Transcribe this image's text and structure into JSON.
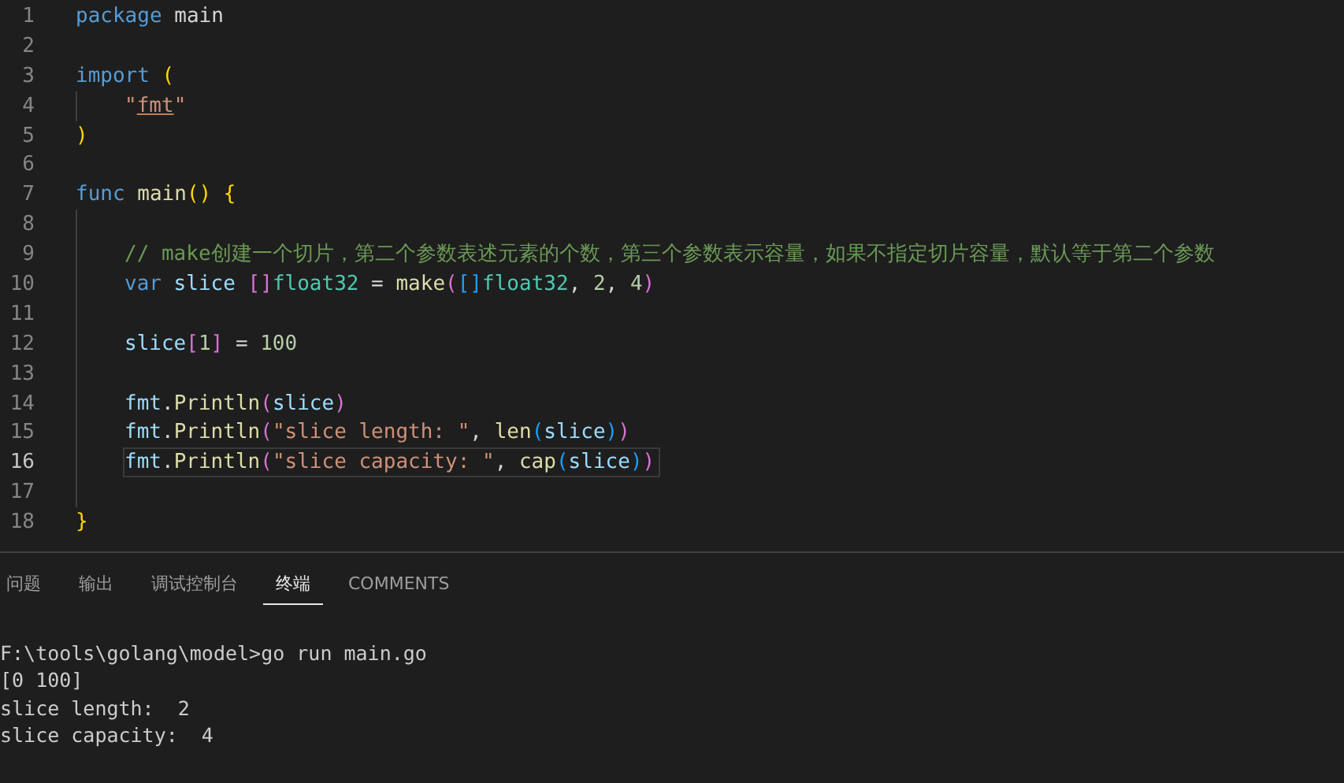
{
  "editor": {
    "lines": [
      {
        "number": "1",
        "current": false,
        "tokens": [
          {
            "kind": "keyword",
            "text": "package"
          },
          {
            "kind": "plain",
            "text": " main"
          }
        ]
      },
      {
        "number": "2",
        "current": false
      },
      {
        "number": "3",
        "current": false,
        "tokens": [
          {
            "kind": "keyword",
            "text": "import"
          },
          {
            "kind": "bracket1",
            "text": " ("
          }
        ],
        "children": [
          {
            "number": "4",
            "current": false,
            "tokens": [
              {
                "kind": "string",
                "text": "\""
              },
              {
                "kind": "import-path",
                "text": "fmt"
              },
              {
                "kind": "string",
                "text": "\""
              }
            ]
          }
        ]
      },
      {
        "number": "5",
        "current": false,
        "tokens": [
          {
            "kind": "bracket1",
            "text": ")"
          }
        ]
      },
      {
        "number": "6",
        "current": false
      },
      {
        "number": "7",
        "current": false,
        "tokens": [
          {
            "kind": "keyword",
            "text": "func"
          },
          {
            "kind": "function",
            "text": " main"
          },
          {
            "kind": "bracket1",
            "text": "() {"
          }
        ],
        "children": [
          {
            "number": "8",
            "current": false
          },
          {
            "number": "9",
            "current": false,
            "tokens": [
              {
                "kind": "comment",
                "text": "// make创建一个切片，第二个参数表述元素的个数，第三个参数表示容量，如果不指定切片容量，默认等于第二个参数"
              }
            ]
          },
          {
            "number": "10",
            "current": false,
            "tokens": [
              {
                "kind": "keyword",
                "text": "var"
              },
              {
                "kind": "variable",
                "text": " slice "
              },
              {
                "kind": "bracket2",
                "text": "[]"
              },
              {
                "kind": "type",
                "text": "float32"
              },
              {
                "kind": "plain",
                "text": " = "
              },
              {
                "kind": "function",
                "text": "make"
              },
              {
                "kind": "bracket2",
                "text": "("
              },
              {
                "kind": "bracket3",
                "text": "[]"
              },
              {
                "kind": "type",
                "text": "float32"
              },
              {
                "kind": "plain",
                "text": ", "
              },
              {
                "kind": "number",
                "text": "2"
              },
              {
                "kind": "plain",
                "text": ", "
              },
              {
                "kind": "number",
                "text": "4"
              },
              {
                "kind": "bracket2",
                "text": ")"
              }
            ]
          },
          {
            "number": "11",
            "current": false
          },
          {
            "number": "12",
            "current": false,
            "tokens": [
              {
                "kind": "variable",
                "text": "slice"
              },
              {
                "kind": "bracket2",
                "text": "["
              },
              {
                "kind": "number",
                "text": "1"
              },
              {
                "kind": "bracket2",
                "text": "]"
              },
              {
                "kind": "plain",
                "text": " = "
              },
              {
                "kind": "number",
                "text": "100"
              }
            ]
          },
          {
            "number": "13",
            "current": false
          },
          {
            "number": "14",
            "current": false,
            "tokens": [
              {
                "kind": "variable",
                "text": "fmt"
              },
              {
                "kind": "plain",
                "text": "."
              },
              {
                "kind": "function",
                "text": "Println"
              },
              {
                "kind": "bracket2",
                "text": "("
              },
              {
                "kind": "variable",
                "text": "slice"
              },
              {
                "kind": "bracket2",
                "text": ")"
              }
            ]
          },
          {
            "number": "15",
            "current": false,
            "tokens": [
              {
                "kind": "variable",
                "text": "fmt"
              },
              {
                "kind": "plain",
                "text": "."
              },
              {
                "kind": "function",
                "text": "Println"
              },
              {
                "kind": "bracket2",
                "text": "("
              },
              {
                "kind": "string",
                "text": "\"slice length: \""
              },
              {
                "kind": "plain",
                "text": ", "
              },
              {
                "kind": "function",
                "text": "len"
              },
              {
                "kind": "bracket3",
                "text": "("
              },
              {
                "kind": "variable",
                "text": "slice"
              },
              {
                "kind": "bracket3",
                "text": ")"
              },
              {
                "kind": "bracket2",
                "text": ")"
              }
            ]
          },
          {
            "number": "16",
            "current": true,
            "tokens": [
              {
                "kind": "variable",
                "text": "fmt"
              },
              {
                "kind": "plain",
                "text": "."
              },
              {
                "kind": "function",
                "text": "Println"
              },
              {
                "kind": "bracket2",
                "text": "("
              },
              {
                "kind": "string",
                "text": "\"slice capacity: \""
              },
              {
                "kind": "plain",
                "text": ", "
              },
              {
                "kind": "function",
                "text": "cap"
              },
              {
                "kind": "bracket3",
                "text": "("
              },
              {
                "kind": "variable",
                "text": "slice"
              },
              {
                "kind": "bracket3",
                "text": ")"
              },
              {
                "kind": "bracket2",
                "text": ")"
              }
            ]
          },
          {
            "number": "17",
            "current": false
          }
        ]
      },
      {
        "number": "18",
        "current": false,
        "tokens": [
          {
            "kind": "bracket1",
            "text": "}"
          }
        ]
      }
    ]
  },
  "panel": {
    "tabs": [
      {
        "label": "问题",
        "selected": false
      },
      {
        "label": "输出",
        "selected": false
      },
      {
        "label": "调试控制台",
        "selected": false
      },
      {
        "label": "终端",
        "selected": true
      },
      {
        "label": "COMMENTS",
        "selected": false
      }
    ],
    "terminal_lines": [
      "F:\\tools\\golang\\model>go run main.go",
      "[0 100]",
      "slice length:  2",
      "slice capacity:  4"
    ]
  }
}
